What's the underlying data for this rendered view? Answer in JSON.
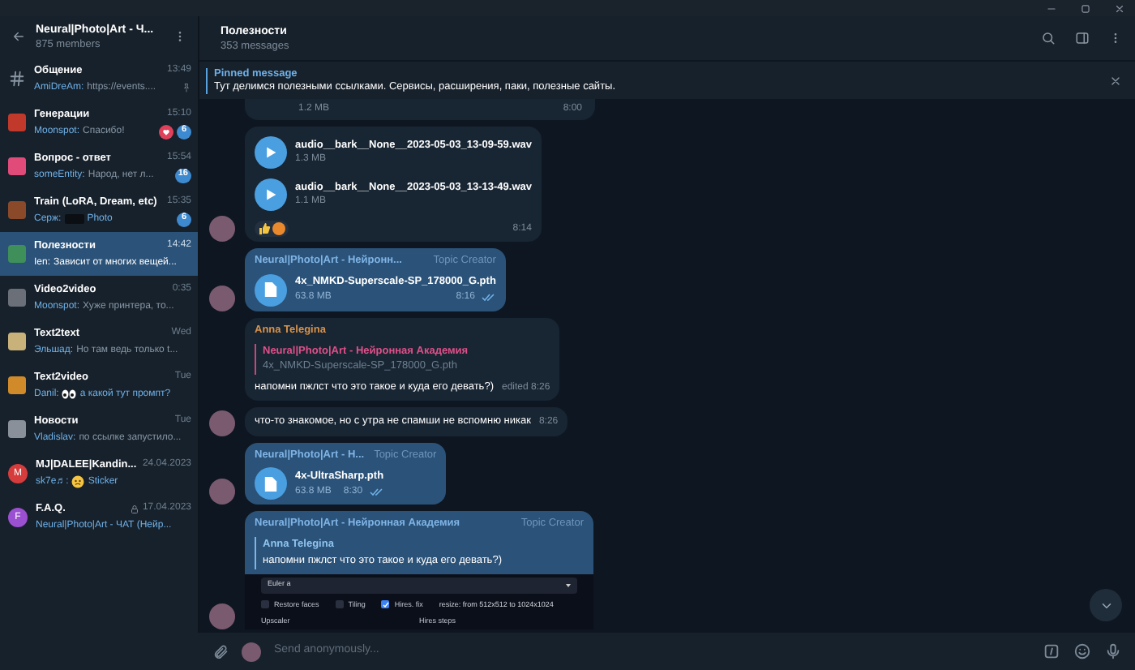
{
  "sidebar": {
    "title": "Neural|Photo|Art - Ч...",
    "subtitle": "875 members",
    "chats": [
      {
        "kind": "hash",
        "title": "Общение",
        "time": "13:49",
        "sender": "AmiDreAm:",
        "text": "https://events....",
        "pinned": true,
        "selected": false
      },
      {
        "kind": "image",
        "color": "#c0392b",
        "title": "Генерации",
        "time": "15:10",
        "sender": "Moonspot:",
        "text": "Спасибо!",
        "reaction": true,
        "badge": "6",
        "selected": false
      },
      {
        "kind": "image",
        "color": "#e04b7a",
        "title": "Вопрос - ответ",
        "time": "15:54",
        "sender": "someEntity:",
        "text": "Народ, нет л...",
        "badge": "16",
        "selected": false
      },
      {
        "kind": "image",
        "color": "#8a4a2a",
        "title": "Train (LoRA, Dream, etc)",
        "time": "15:35",
        "sender": "Серж:",
        "text": "Photo",
        "attachment": {
          "kind": "photo"
        },
        "badge": "6",
        "selected": false
      },
      {
        "kind": "image",
        "color": "#3f8f5a",
        "title": "Полезности",
        "time": "14:42",
        "sender": "Ien:",
        "text": "Зависит от многих вещей...",
        "selected": true
      },
      {
        "kind": "image",
        "color": "#6b6f78",
        "title": "Video2video",
        "time": "0:35",
        "sender": "Moonspot:",
        "text": "Хуже принтера, то...",
        "selected": false
      },
      {
        "kind": "image",
        "color": "#c9b27a",
        "title": "Text2text",
        "time": "Wed",
        "sender": "Эльшад:",
        "text": "Но там ведь только t...",
        "selected": false
      },
      {
        "kind": "image",
        "color": "#d08a2a",
        "title": "Text2video",
        "time": "Tue",
        "sender": "Danil:",
        "text": "а какой тут промпт?",
        "attachment": {
          "kind": "eyes"
        },
        "selected": false
      },
      {
        "kind": "image",
        "color": "#8a9099",
        "title": "Новости",
        "time": "Tue",
        "sender": "Vladislav:",
        "text": "по ссылке запустило...",
        "selected": false
      },
      {
        "kind": "letter",
        "letter": "M",
        "color": "#d63c3c",
        "title": "MJ|DALEE|Kandin...",
        "time": "24.04.2023",
        "sender": "sk7e♬:",
        "text": "Sticker",
        "attachment": {
          "kind": "sticker"
        },
        "selected": false
      },
      {
        "kind": "letter",
        "letter": "F",
        "color": "#9b4fd1",
        "title": "F.A.Q.",
        "time": "17.04.2023",
        "locked": true,
        "text": "Neural|Photo|Art - ЧАТ (Нейр...",
        "selected": false
      }
    ]
  },
  "chat": {
    "title": "Полезности",
    "subtitle": "353 messages",
    "pinned": {
      "label": "Pinned message",
      "text": "Тут делимся полезными ссылками. Сервисы, расширения, паки, полезные сайты."
    }
  },
  "messages": [
    {
      "kind": "file_tail",
      "size": "1.2 MB",
      "time": "8:00"
    },
    {
      "kind": "audio",
      "avatar": true,
      "files": [
        {
          "name": "audio__bark__None__2023-05-03_13-09-59.wav",
          "size": "1.3 MB"
        },
        {
          "name": "audio__bark__None__2023-05-03_13-13-49.wav",
          "size": "1.1 MB"
        }
      ],
      "time": "8:14"
    },
    {
      "kind": "document",
      "avatar": true,
      "author": "Neural|Photo|Art - Нейронн...",
      "badge": "Topic Creator",
      "name": "4x_NMKD-Superscale-SP_178000_G.pth",
      "size": "63.8 MB",
      "time": "8:16",
      "read": true
    },
    {
      "kind": "reply",
      "avatar": false,
      "author": "Anna Telegina",
      "reply_author": "Neural|Photo|Art - Нейронная Академия",
      "reply_text": "4x_NMKD-Superscale-SP_178000_G.pth",
      "text": "напомни пжлст что это такое и куда его девать?)",
      "time": "edited 8:26"
    },
    {
      "kind": "text",
      "avatar": true,
      "text": "что-то знакомое, но с утра не спамши не вспомню никак",
      "time": "8:26"
    },
    {
      "kind": "document",
      "avatar": true,
      "author": "Neural|Photo|Art - Н...",
      "badge": "Topic Creator",
      "name": "4x-UltraSharp.pth",
      "size": "63.8 MB",
      "time": "8:30",
      "read": true
    },
    {
      "kind": "screenshot",
      "avatar": true,
      "author": "Neural|Photo|Art - Нейронная Академия",
      "badge": "Topic Creator",
      "reply_author": "Anna Telegina",
      "reply_text": "напомни пжлст что это такое и куда его девать?)",
      "image": {
        "dropdown": "Euler a",
        "checkboxes": [
          {
            "label": "Restore faces",
            "checked": false
          },
          {
            "label": "Tiling",
            "checked": false
          },
          {
            "label": "Hires. fix",
            "checked": true
          }
        ],
        "note": "resize: from 512x512 to 1024x1024",
        "labels": [
          "Upscaler",
          "Hires steps"
        ]
      }
    }
  ],
  "composer": {
    "placeholder": "Send anonymously..."
  }
}
